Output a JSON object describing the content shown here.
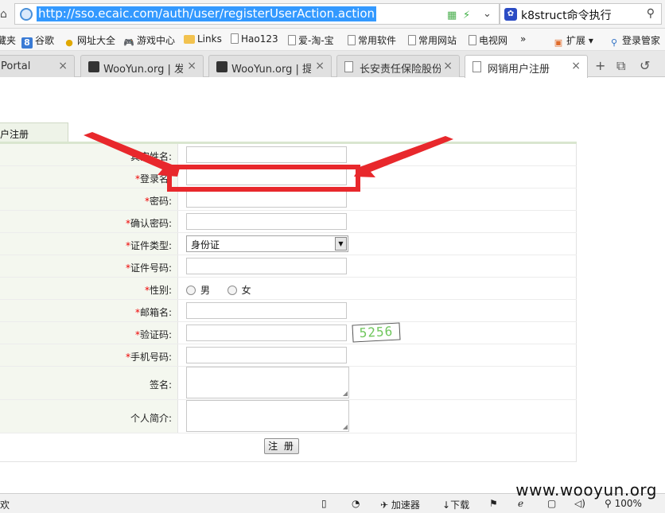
{
  "browser": {
    "url": "http://sso.ecaic.com/auth/user/registerUserAction.action",
    "search_text": "k8struct命令执行",
    "bookmarks": [
      {
        "label": "藏夹"
      },
      {
        "label": "谷歌"
      },
      {
        "label": "网址大全"
      },
      {
        "label": "游戏中心"
      },
      {
        "label": "Links"
      },
      {
        "label": "Hao123"
      },
      {
        "label": "爱-淘-宝"
      },
      {
        "label": "常用软件"
      },
      {
        "label": "常用网站"
      },
      {
        "label": "电视网"
      },
      {
        "label": "»"
      },
      {
        "label": "扩展"
      },
      {
        "label": "登录管家"
      }
    ],
    "tabs": [
      {
        "title": "Portal",
        "icon": "doc"
      },
      {
        "title": "WooYun.org | 发布",
        "icon": "wooyun"
      },
      {
        "title": "WooYun.org | 提交",
        "icon": "wooyun"
      },
      {
        "title": "长安责任保险股份有",
        "icon": "doc"
      },
      {
        "title": "网销用户注册",
        "icon": "doc"
      }
    ],
    "status": {
      "left": "欢",
      "accelerator": "加速器",
      "download": "下载",
      "zoom": "100%"
    }
  },
  "form": {
    "tab_label": "用户注册",
    "req_mark": "*",
    "fields": {
      "real_name": "真实姓名:",
      "login_name": "登录名:",
      "password": "密码:",
      "confirm_password": "确认密码:",
      "id_type": "证件类型:",
      "id_number": "证件号码:",
      "gender": "性别:",
      "email": "邮箱名:",
      "captcha": "验证码:",
      "mobile": "手机号码:",
      "signature": "签名:",
      "intro": "个人简介:"
    },
    "id_type_value": "身份证",
    "gender_male": "男",
    "gender_female": "女",
    "captcha_image_text": "5256",
    "submit_label": "注 册"
  },
  "watermark": "www.wooyun.org",
  "colors": {
    "annotation_red": "#e8282c",
    "required_star": "#ee0000",
    "url_highlight": "#3399ff",
    "label_cell_bg": "#f4f7ef"
  }
}
